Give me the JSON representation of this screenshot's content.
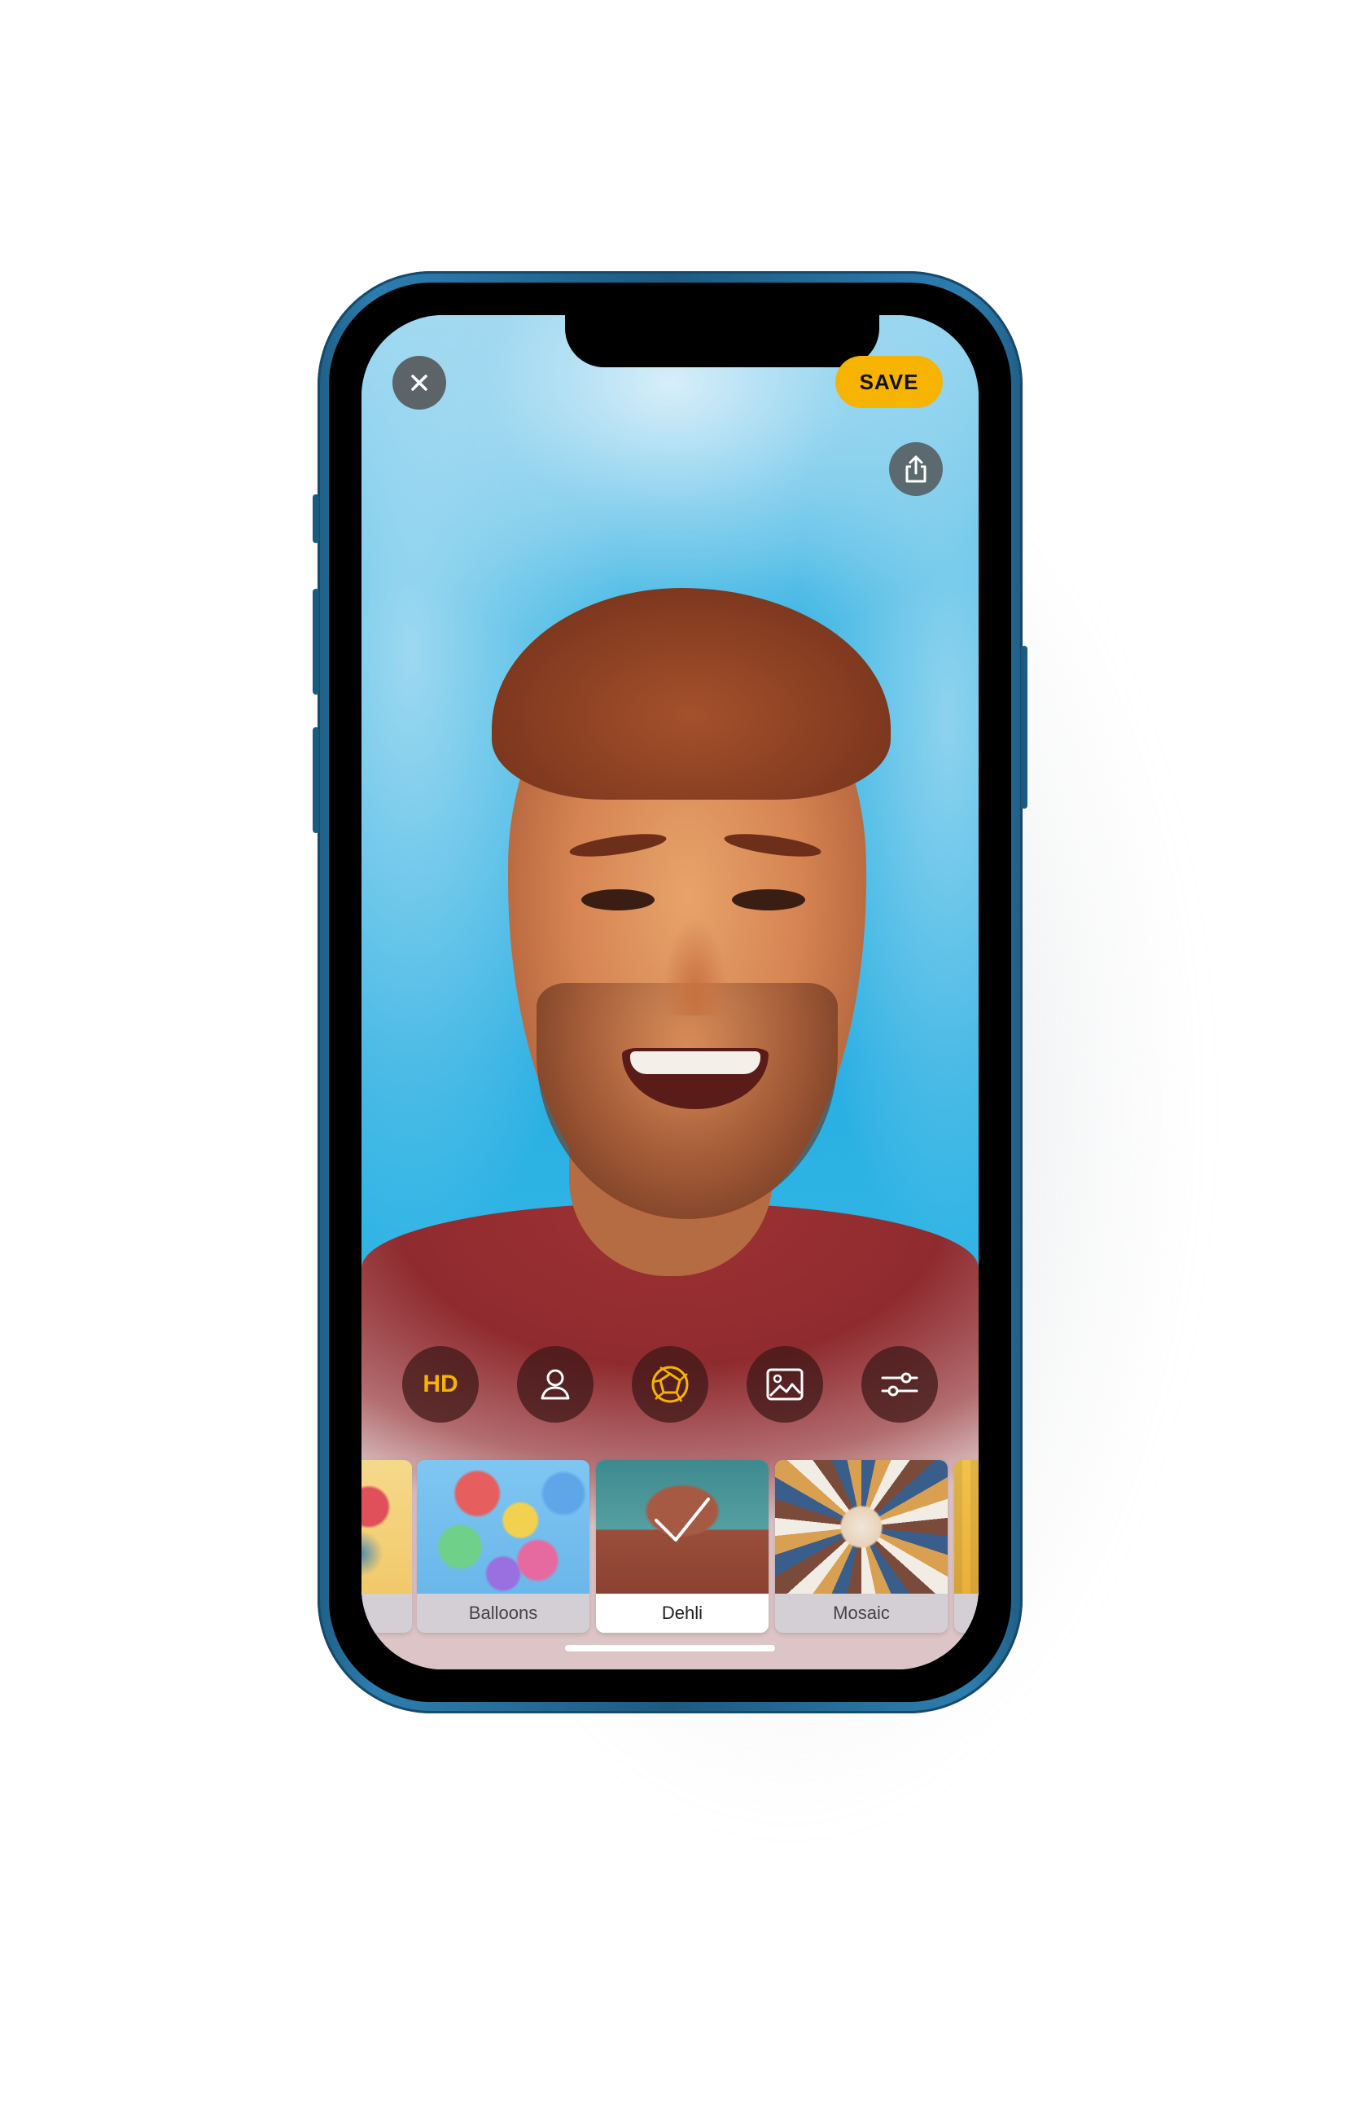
{
  "header": {
    "close_icon": "close-icon",
    "save_label": "SAVE",
    "share_icon": "share-icon"
  },
  "toolbar": {
    "hd_label": "HD",
    "items": [
      "hd",
      "person-icon",
      "aperture-icon",
      "image-icon",
      "sliders-icon"
    ],
    "active": "aperture-icon"
  },
  "filters": {
    "items": [
      {
        "label": ""
      },
      {
        "label": "Balloons"
      },
      {
        "label": "Dehli"
      },
      {
        "label": "Mosaic"
      },
      {
        "label": ""
      }
    ],
    "selected": "Dehli"
  },
  "colors": {
    "accent": "#f6b300",
    "phone_frame": "#1f5f86",
    "sky": "#2aa9dc",
    "shirt": "#9e3234"
  }
}
